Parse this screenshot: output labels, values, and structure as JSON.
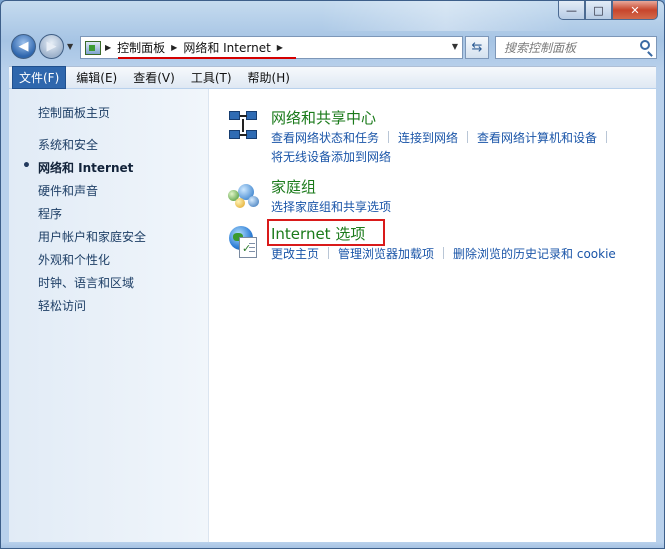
{
  "window": {
    "caption_minimize": "—",
    "caption_maximize": "□",
    "caption_close": "✕"
  },
  "address_bar": {
    "breadcrumbs": [
      "控制面板",
      "网络和 Internet"
    ],
    "search_placeholder": "搜索控制面板"
  },
  "menu": {
    "items": [
      "文件(F)",
      "编辑(E)",
      "查看(V)",
      "工具(T)",
      "帮助(H)"
    ],
    "active_index": 0
  },
  "sidebar": {
    "home": "控制面板主页",
    "items": [
      "系统和安全",
      "网络和 Internet",
      "硬件和声音",
      "程序",
      "用户帐户和家庭安全",
      "外观和个性化",
      "时钟、语言和区域",
      "轻松访问"
    ],
    "current_index": 1
  },
  "categories": [
    {
      "icon": "network-sharing-center-icon",
      "title": "网络和共享中心",
      "links": [
        "查看网络状态和任务",
        "连接到网络",
        "查看网络计算机和设备",
        "将无线设备添加到网络"
      ]
    },
    {
      "icon": "homegroup-icon",
      "title": "家庭组",
      "links": [
        "选择家庭组和共享选项"
      ]
    },
    {
      "icon": "internet-options-icon",
      "title": "Internet 选项",
      "links": [
        "更改主页",
        "管理浏览器加载项",
        "删除浏览的历史记录和 cookie"
      ],
      "highlighted": true
    }
  ],
  "colors": {
    "highlight_box": "#d91a1a",
    "title_green": "#1a7a1a",
    "link_blue": "#1a55a8"
  }
}
